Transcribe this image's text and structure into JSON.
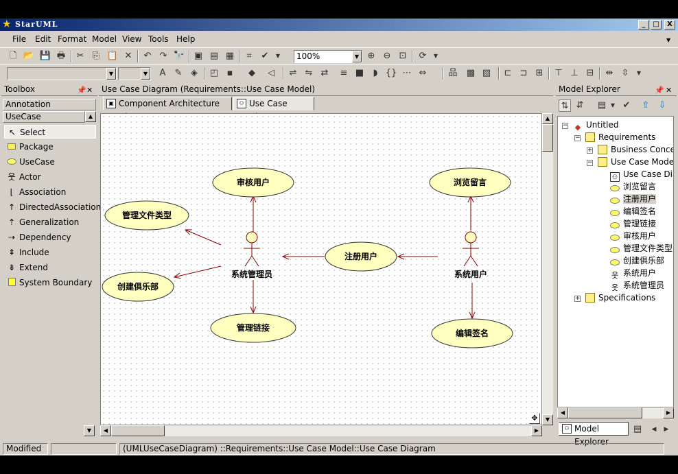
{
  "window": {
    "title": "StarUML",
    "buttons": {
      "minimize": "_",
      "maximize": "□",
      "close": "X"
    }
  },
  "menu": [
    "File",
    "Edit",
    "Format",
    "Model",
    "View",
    "Tools",
    "Help"
  ],
  "toolbar": {
    "zoom": "100%"
  },
  "toolbox": {
    "title": "Toolbox",
    "groups": {
      "annotation": "Annotation",
      "usecase": "UseCase"
    },
    "items": [
      "Select",
      "Package",
      "UseCase",
      "Actor",
      "Association",
      "DirectedAssociation",
      "Generalization",
      "Dependency",
      "Include",
      "Extend",
      "System Boundary"
    ]
  },
  "diagram": {
    "header": "Use Case Diagram (Requirements::Use Case Model)",
    "tabs": [
      "Component Architecture Diagram",
      "Use Case Diagram"
    ],
    "usecases": {
      "review_user": "审核用户",
      "browse_msg": "浏览留言",
      "manage_filetype": "管理文件类型",
      "register_user": "注册用户",
      "create_club": "创建俱乐部",
      "manage_links": "管理链接",
      "edit_signature": "编辑签名"
    },
    "actors": {
      "admin": "系统管理员",
      "user": "系统用户"
    }
  },
  "explorer": {
    "title": "Model Explorer",
    "tree": {
      "root": "Untitled",
      "requirements": "Requirements",
      "business_concept": "Business Concept I",
      "use_case_model": "Use Case Model",
      "use_case_diagram": "Use Case Diagr",
      "children": [
        "浏览留言",
        "注册用户",
        "编辑签名",
        "管理链接",
        "审核用户",
        "管理文件类型",
        "创建俱乐部",
        "系统用户",
        "系统管理员"
      ],
      "specifications": "Specifications"
    },
    "bottom_tab": "Model Explorer"
  },
  "status": {
    "state": "Modified",
    "path": "(UMLUseCaseDiagram) ::Requirements::Use Case Model::Use Case Diagram"
  }
}
